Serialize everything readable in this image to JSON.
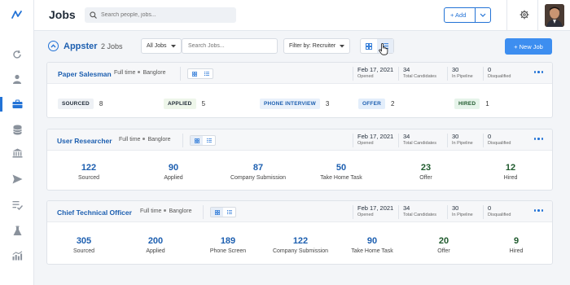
{
  "app": {
    "page_title": "Jobs",
    "search_placeholder": "Search people, jobs...",
    "add_label": "+ Add",
    "colors": {
      "accent": "#2373d6",
      "primary_button": "#3d8ef0",
      "title_blue": "#1d5fb0"
    }
  },
  "sidebar": {
    "icons": [
      "logo-icon",
      "history-icon",
      "person-icon",
      "briefcase-icon",
      "database-icon",
      "bank-icon",
      "send-icon",
      "checklist-icon",
      "flask-icon",
      "analytics-icon"
    ],
    "active": "briefcase-icon"
  },
  "subheader": {
    "org_name": "Appster",
    "job_count": "2 Jobs",
    "all_jobs_label": "All Jobs",
    "search_jobs_placeholder": "Search Jobs...",
    "filter_label": "Filter by: Recruiter",
    "new_job_label": "+ New Job"
  },
  "jobs": [
    {
      "title": "Paper Salesman",
      "type": "Full time",
      "location": "Banglore",
      "opened": "Feb 17, 2021",
      "opened_label": "Opened",
      "total_candidates": "34",
      "total_label": "Total Candidates",
      "in_pipeline": "30",
      "pipeline_label": "In Pipeline",
      "disqualified": "0",
      "disqualified_label": "Disqualified",
      "stages": [
        {
          "label": "SOURCED",
          "count": "8",
          "bg": "#eef1f5",
          "fg": "#1f2a37"
        },
        {
          "label": "APPLIED",
          "count": "5",
          "bg": "#eef6ea",
          "fg": "#1f2a37"
        },
        {
          "label": "PHONE INTERVIEW",
          "count": "3",
          "bg": "#e9f1fb",
          "fg": "#1d5fb0"
        },
        {
          "label": "OFFER",
          "count": "2",
          "bg": "#e3eefb",
          "fg": "#1d5fb0"
        },
        {
          "label": "HIRED",
          "count": "1",
          "bg": "#e6f4ea",
          "fg": "#1f5a2d"
        }
      ]
    },
    {
      "title": "User Researcher",
      "type": "Full time",
      "location": "Banglore",
      "opened": "Feb 17, 2021",
      "opened_label": "Opened",
      "total_candidates": "34",
      "total_label": "Total Candidates",
      "in_pipeline": "30",
      "pipeline_label": "In Pipeline",
      "disqualified": "0",
      "disqualified_label": "Disqualified",
      "stats": [
        {
          "num": "122",
          "label": "Sourced",
          "color": "#1d5fb0"
        },
        {
          "num": "90",
          "label": "Applied",
          "color": "#1d5fb0"
        },
        {
          "num": "87",
          "label": "Company Submission",
          "color": "#1d5fb0"
        },
        {
          "num": "50",
          "label": "Take Home Task",
          "color": "#1d5fb0"
        },
        {
          "num": "23",
          "label": "Offer",
          "color": "#1f5a2d"
        },
        {
          "num": "12",
          "label": "Hired",
          "color": "#1f5a2d"
        }
      ]
    },
    {
      "title": "Chief Technical Officer",
      "type": "Full time",
      "location": "Banglore",
      "opened": "Feb 17, 2021",
      "opened_label": "Opened",
      "total_candidates": "34",
      "total_label": "Total Candidates",
      "in_pipeline": "30",
      "pipeline_label": "In Pipeline",
      "disqualified": "0",
      "disqualified_label": "Disqualified",
      "stats": [
        {
          "num": "305",
          "label": "Sourced",
          "color": "#1d5fb0"
        },
        {
          "num": "200",
          "label": "Applied",
          "color": "#1d5fb0"
        },
        {
          "num": "189",
          "label": "Phone Screen",
          "color": "#1d5fb0"
        },
        {
          "num": "122",
          "label": "Company Submission",
          "color": "#1d5fb0"
        },
        {
          "num": "90",
          "label": "Take Home Task",
          "color": "#1d5fb0"
        },
        {
          "num": "20",
          "label": "Offer",
          "color": "#1f5a2d"
        },
        {
          "num": "9",
          "label": "Hired",
          "color": "#1f5a2d"
        }
      ]
    }
  ]
}
